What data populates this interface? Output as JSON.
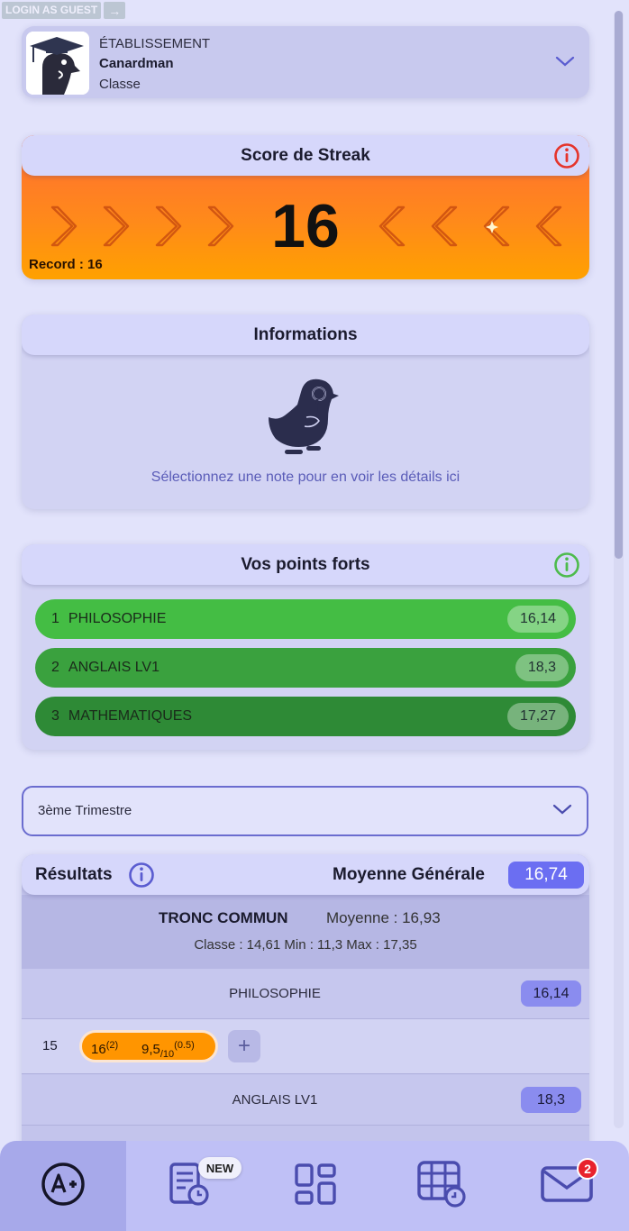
{
  "guest": {
    "login_label": "LOGIN AS GUEST",
    "arrow": "→"
  },
  "school": {
    "label": "ÉTABLISSEMENT",
    "name": "Canardman",
    "class_label": "Classe"
  },
  "streak": {
    "title": "Score de Streak",
    "score": "16",
    "record": "Record : 16"
  },
  "informations": {
    "title": "Informations",
    "hint": "Sélectionnez une note pour en voir les détails ici"
  },
  "strengths": {
    "title": "Vos points forts",
    "items": [
      {
        "rank": "1",
        "subject": "PHILOSOPHIE",
        "value": "16,14",
        "color": "#44bd44"
      },
      {
        "rank": "2",
        "subject": "ANGLAIS LV1",
        "value": "18,3",
        "color": "#3aa13e"
      },
      {
        "rank": "3",
        "subject": "MATHEMATIQUES",
        "value": "17,27",
        "color": "#2e8a36"
      }
    ]
  },
  "period": {
    "selected": "3ème Trimestre"
  },
  "results": {
    "title": "Résultats",
    "general_label": "Moyenne Générale",
    "general_value": "16,74",
    "group": {
      "name": "TRONC COMMUN",
      "average": "Moyenne : 16,93",
      "stats": "Classe : 14,61   Min : 11,3   Max : 17,35"
    },
    "subjects": [
      {
        "name": "PHILOSOPHIE",
        "average": "16,14",
        "row_value": "15",
        "grade1": "16",
        "grade1_coef": "(2)",
        "grade2": "9,5",
        "grade2_denom": "/10",
        "grade2_coef": "(0.5)"
      },
      {
        "name": "ANGLAIS LV1",
        "average": "18,3"
      }
    ]
  },
  "nav": {
    "new_badge": "NEW",
    "mail_count": "2",
    "items": [
      "grades-icon",
      "homework-icon",
      "dashboard-icon",
      "timetable-icon",
      "mail-icon"
    ]
  },
  "colors": {
    "accent": "#6b6ef2",
    "streak": "#ff8a1a",
    "bg": "#e2e3fb"
  }
}
